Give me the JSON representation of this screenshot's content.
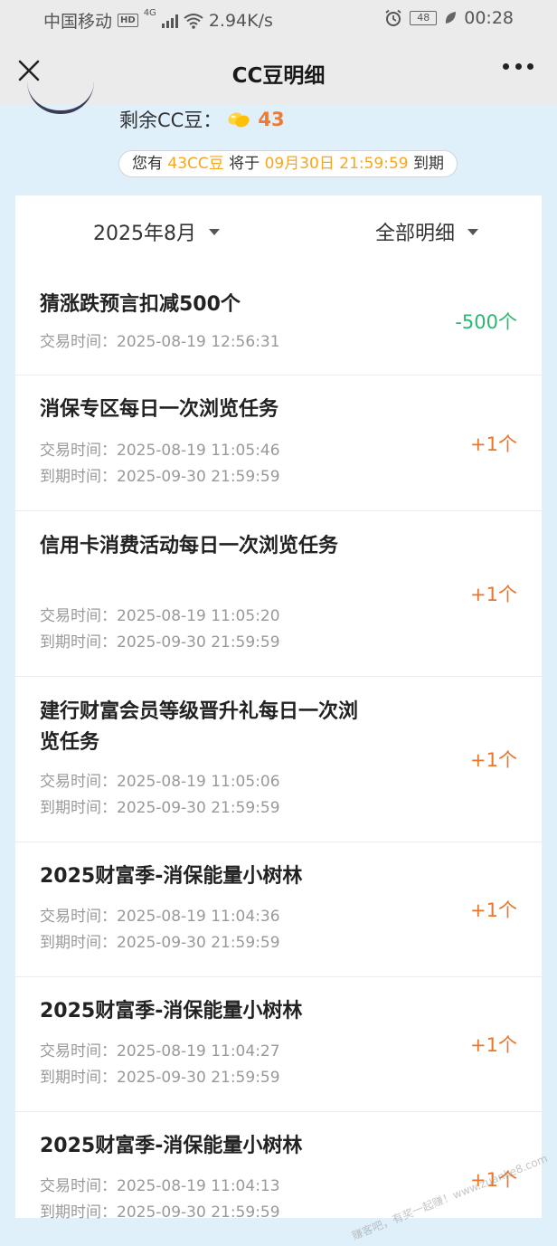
{
  "status_bar": {
    "carrier": "中国移动",
    "hd": "HD",
    "network": "4G",
    "speed": "2.94K/s",
    "battery": "48",
    "time": "00:28"
  },
  "nav": {
    "title": "CC豆明细"
  },
  "summary": {
    "label": "剩余CC豆：",
    "count": "43",
    "expiry_prefix": "您有 ",
    "expiry_amount": "43CC豆",
    "expiry_mid": " 将于 ",
    "expiry_date": "09月30日 21:59:59",
    "expiry_suffix": " 到期"
  },
  "filters": {
    "month": "2025年8月",
    "type": "全部明细"
  },
  "records": [
    {
      "title": "猜涨跌预言扣减500个",
      "trade": "交易时间：2025-08-19 12:56:31",
      "expire": "",
      "amount": "-500个"
    },
    {
      "title": "消保专区每日一次浏览任务",
      "trade": "交易时间：2025-08-19 11:05:46",
      "expire": "到期时间：2025-09-30 21:59:59",
      "amount": "+1个"
    },
    {
      "title": "信用卡消费活动每日一次浏览任务",
      "trade": "交易时间：2025-08-19 11:05:20",
      "expire": "到期时间：2025-09-30 21:59:59",
      "amount": "+1个"
    },
    {
      "title": "建行财富会员等级晋升礼每日一次浏览任务",
      "trade": "交易时间：2025-08-19 11:05:06",
      "expire": "到期时间：2025-09-30 21:59:59",
      "amount": "+1个"
    },
    {
      "title": "2025财富季-消保能量小树林",
      "trade": "交易时间：2025-08-19 11:04:36",
      "expire": "到期时间：2025-09-30 21:59:59",
      "amount": "+1个"
    },
    {
      "title": "2025财富季-消保能量小树林",
      "trade": "交易时间：2025-08-19 11:04:27",
      "expire": "到期时间：2025-09-30 21:59:59",
      "amount": "+1个"
    },
    {
      "title": "2025财富季-消保能量小树林",
      "trade": "交易时间：2025-08-19 11:04:13",
      "expire": "到期时间：2025-09-30 21:59:59",
      "amount": "+1个"
    }
  ],
  "watermark": "赚客吧，有奖一起赚！www.zuanke8.com",
  "icons": {
    "close": "close-icon",
    "more": "more-icon",
    "bean": "bean-icon",
    "caret": "caret-down-icon"
  },
  "colors": {
    "negative": "#2bb673",
    "positive": "#e8762d",
    "highlight": "#f5a623"
  }
}
